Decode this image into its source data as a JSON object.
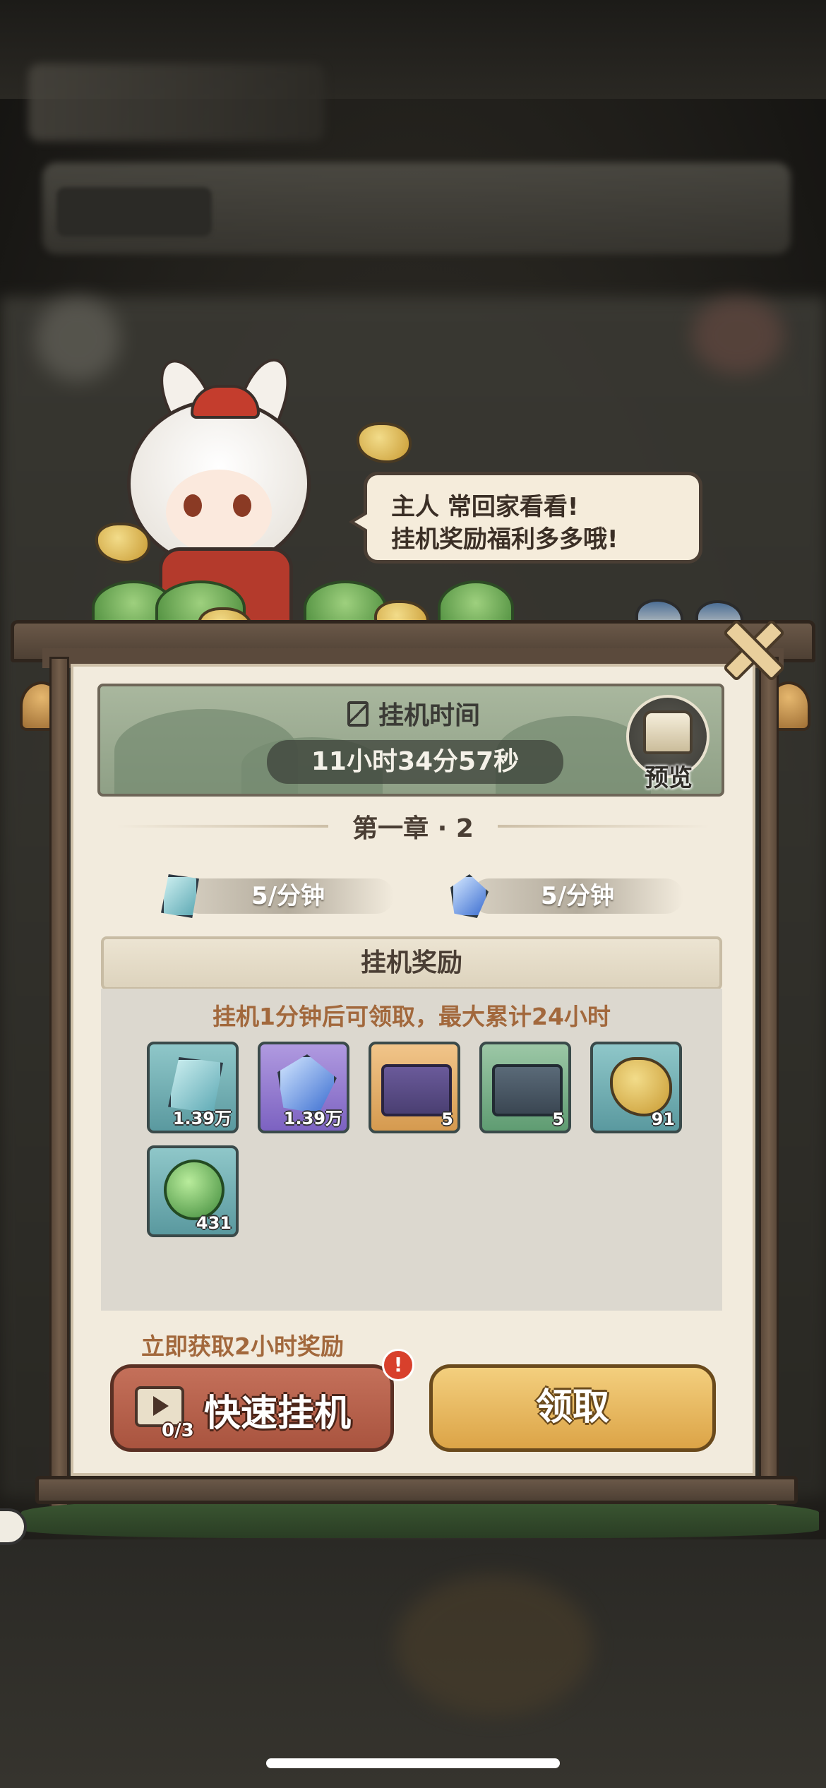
{
  "dialog": {
    "speech": [
      "主人 常回家看看!",
      "挂机奖励福利多多哦!"
    ],
    "idle_title": "挂机时间",
    "idle_timer": "11小时34分57秒",
    "preview_label": "预览",
    "chapter": "第一章 · 2",
    "rates": [
      {
        "icon": "teal-crystal-icon",
        "label": "5/分钟"
      },
      {
        "icon": "blue-crystal-icon",
        "label": "5/分钟"
      }
    ],
    "rewards_title": "挂机奖励",
    "rewards_note": "挂机1分钟后可领取，最大累计24小时",
    "rewards": [
      {
        "icon": "teal-crystal-icon",
        "bg": "teal",
        "count": "1.39万"
      },
      {
        "icon": "blue-crystal-cluster-icon",
        "bg": "purple",
        "count": "1.39万"
      },
      {
        "icon": "mystery-chest-icon",
        "bg": "orange",
        "count": "5"
      },
      {
        "icon": "mystery-crate-icon",
        "bg": "green",
        "count": "5"
      },
      {
        "icon": "gold-ore-icon",
        "bg": "teal",
        "count": "91"
      },
      {
        "icon": "green-sprout-orb-icon",
        "bg": "teal",
        "count": "431"
      }
    ],
    "quick_hint": "立即获取2小时奖励",
    "quick_button": "快速挂机",
    "quick_count": "0/3",
    "alert_badge": "!",
    "claim_button": "领取"
  },
  "colors": {
    "accent_red": "#c4705a",
    "accent_gold": "#f3cf7e",
    "hint_brown": "#a2683c"
  }
}
